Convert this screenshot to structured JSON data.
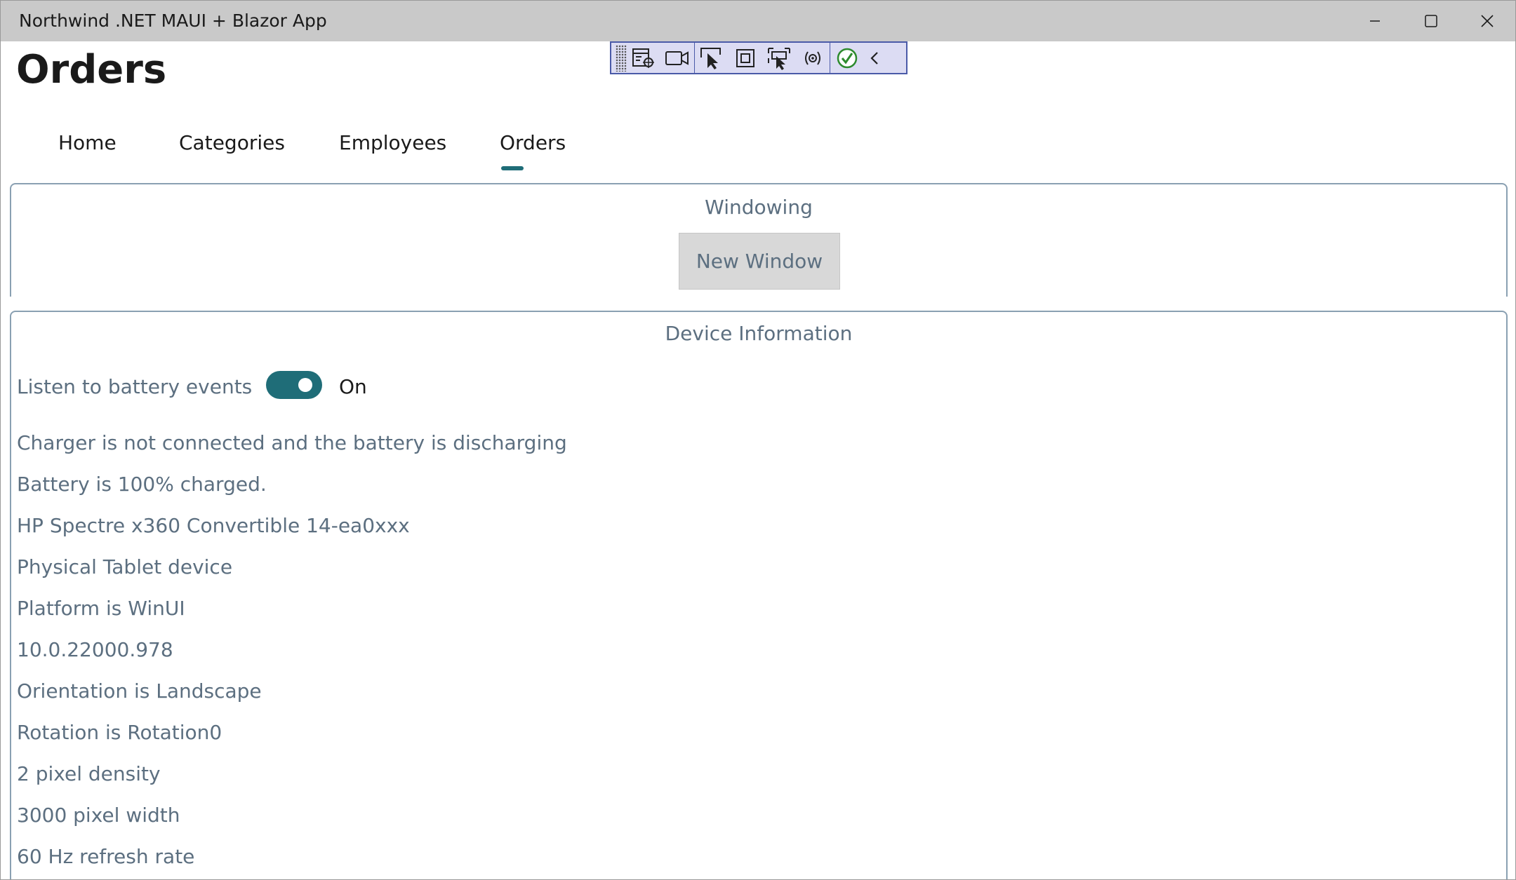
{
  "window": {
    "title": "Northwind .NET MAUI + Blazor App",
    "caption_icons": [
      "minimize-icon",
      "maximize-icon",
      "close-icon"
    ]
  },
  "page": {
    "title": "Orders"
  },
  "debug_toolbar": {
    "icons": [
      "grip-icon",
      "live-visual-tree-icon",
      "record-icon",
      "select-element-icon",
      "display-layout-adorners-icon",
      "track-focus-icon",
      "binding-failures-icon",
      "hot-reload-status-icon",
      "collapse-icon"
    ]
  },
  "tabs": [
    {
      "label": "Home"
    },
    {
      "label": "Categories"
    },
    {
      "label": "Employees"
    },
    {
      "label": "Orders",
      "selected": true
    }
  ],
  "windowing": {
    "title": "Windowing",
    "new_window_label": "New Window"
  },
  "device_info": {
    "title": "Device Information",
    "battery_toggle_label": "Listen to battery events",
    "battery_toggle_state": "On",
    "items": [
      "Charger is not connected and the battery is discharging",
      "Battery is 100% charged.",
      "HP Spectre x360 Convertible 14-ea0xxx",
      "Physical Tablet device",
      "Platform is WinUI",
      "10.0.22000.978",
      "Orientation is Landscape",
      "Rotation is Rotation0",
      "2 pixel density",
      "3000 pixel width",
      "60 Hz refresh rate"
    ]
  },
  "colors": {
    "accent": "#1f6d78",
    "label_text": "#5c6f80",
    "frame_border": "#8aa0b2",
    "titlebar": "#c9c9c9"
  }
}
